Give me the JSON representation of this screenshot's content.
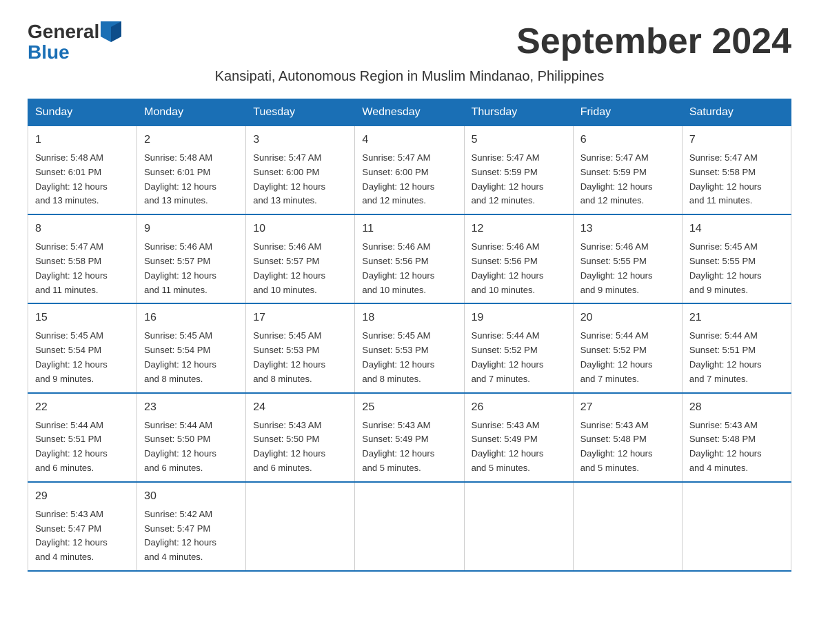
{
  "logo": {
    "general": "General",
    "blue": "Blue"
  },
  "title": "September 2024",
  "subtitle": "Kansipati, Autonomous Region in Muslim Mindanao, Philippines",
  "weekdays": [
    "Sunday",
    "Monday",
    "Tuesday",
    "Wednesday",
    "Thursday",
    "Friday",
    "Saturday"
  ],
  "weeks": [
    [
      {
        "day": "1",
        "sunrise": "5:48 AM",
        "sunset": "6:01 PM",
        "daylight": "12 hours and 13 minutes."
      },
      {
        "day": "2",
        "sunrise": "5:48 AM",
        "sunset": "6:01 PM",
        "daylight": "12 hours and 13 minutes."
      },
      {
        "day": "3",
        "sunrise": "5:47 AM",
        "sunset": "6:00 PM",
        "daylight": "12 hours and 13 minutes."
      },
      {
        "day": "4",
        "sunrise": "5:47 AM",
        "sunset": "6:00 PM",
        "daylight": "12 hours and 12 minutes."
      },
      {
        "day": "5",
        "sunrise": "5:47 AM",
        "sunset": "5:59 PM",
        "daylight": "12 hours and 12 minutes."
      },
      {
        "day": "6",
        "sunrise": "5:47 AM",
        "sunset": "5:59 PM",
        "daylight": "12 hours and 12 minutes."
      },
      {
        "day": "7",
        "sunrise": "5:47 AM",
        "sunset": "5:58 PM",
        "daylight": "12 hours and 11 minutes."
      }
    ],
    [
      {
        "day": "8",
        "sunrise": "5:47 AM",
        "sunset": "5:58 PM",
        "daylight": "12 hours and 11 minutes."
      },
      {
        "day": "9",
        "sunrise": "5:46 AM",
        "sunset": "5:57 PM",
        "daylight": "12 hours and 11 minutes."
      },
      {
        "day": "10",
        "sunrise": "5:46 AM",
        "sunset": "5:57 PM",
        "daylight": "12 hours and 10 minutes."
      },
      {
        "day": "11",
        "sunrise": "5:46 AM",
        "sunset": "5:56 PM",
        "daylight": "12 hours and 10 minutes."
      },
      {
        "day": "12",
        "sunrise": "5:46 AM",
        "sunset": "5:56 PM",
        "daylight": "12 hours and 10 minutes."
      },
      {
        "day": "13",
        "sunrise": "5:46 AM",
        "sunset": "5:55 PM",
        "daylight": "12 hours and 9 minutes."
      },
      {
        "day": "14",
        "sunrise": "5:45 AM",
        "sunset": "5:55 PM",
        "daylight": "12 hours and 9 minutes."
      }
    ],
    [
      {
        "day": "15",
        "sunrise": "5:45 AM",
        "sunset": "5:54 PM",
        "daylight": "12 hours and 9 minutes."
      },
      {
        "day": "16",
        "sunrise": "5:45 AM",
        "sunset": "5:54 PM",
        "daylight": "12 hours and 8 minutes."
      },
      {
        "day": "17",
        "sunrise": "5:45 AM",
        "sunset": "5:53 PM",
        "daylight": "12 hours and 8 minutes."
      },
      {
        "day": "18",
        "sunrise": "5:45 AM",
        "sunset": "5:53 PM",
        "daylight": "12 hours and 8 minutes."
      },
      {
        "day": "19",
        "sunrise": "5:44 AM",
        "sunset": "5:52 PM",
        "daylight": "12 hours and 7 minutes."
      },
      {
        "day": "20",
        "sunrise": "5:44 AM",
        "sunset": "5:52 PM",
        "daylight": "12 hours and 7 minutes."
      },
      {
        "day": "21",
        "sunrise": "5:44 AM",
        "sunset": "5:51 PM",
        "daylight": "12 hours and 7 minutes."
      }
    ],
    [
      {
        "day": "22",
        "sunrise": "5:44 AM",
        "sunset": "5:51 PM",
        "daylight": "12 hours and 6 minutes."
      },
      {
        "day": "23",
        "sunrise": "5:44 AM",
        "sunset": "5:50 PM",
        "daylight": "12 hours and 6 minutes."
      },
      {
        "day": "24",
        "sunrise": "5:43 AM",
        "sunset": "5:50 PM",
        "daylight": "12 hours and 6 minutes."
      },
      {
        "day": "25",
        "sunrise": "5:43 AM",
        "sunset": "5:49 PM",
        "daylight": "12 hours and 5 minutes."
      },
      {
        "day": "26",
        "sunrise": "5:43 AM",
        "sunset": "5:49 PM",
        "daylight": "12 hours and 5 minutes."
      },
      {
        "day": "27",
        "sunrise": "5:43 AM",
        "sunset": "5:48 PM",
        "daylight": "12 hours and 5 minutes."
      },
      {
        "day": "28",
        "sunrise": "5:43 AM",
        "sunset": "5:48 PM",
        "daylight": "12 hours and 4 minutes."
      }
    ],
    [
      {
        "day": "29",
        "sunrise": "5:43 AM",
        "sunset": "5:47 PM",
        "daylight": "12 hours and 4 minutes."
      },
      {
        "day": "30",
        "sunrise": "5:42 AM",
        "sunset": "5:47 PM",
        "daylight": "12 hours and 4 minutes."
      },
      null,
      null,
      null,
      null,
      null
    ]
  ],
  "labels": {
    "sunrise": "Sunrise:",
    "sunset": "Sunset:",
    "daylight": "Daylight:"
  }
}
